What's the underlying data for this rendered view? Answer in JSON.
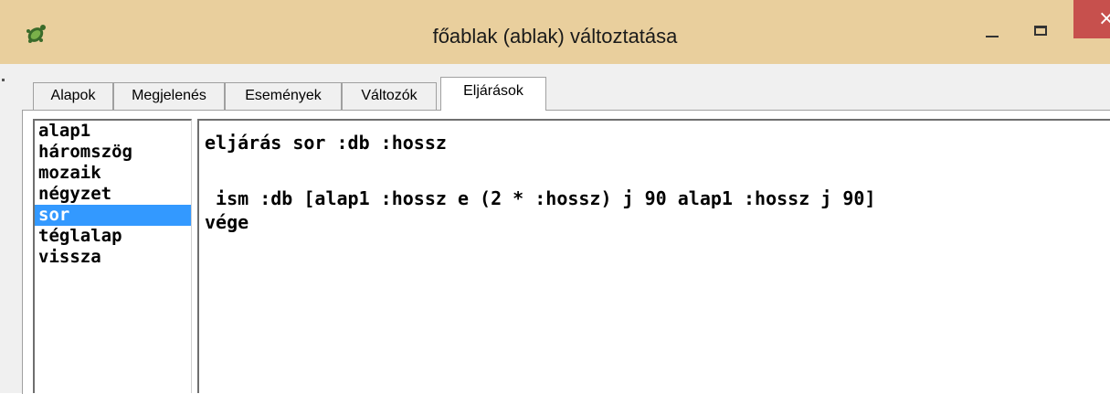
{
  "window": {
    "title": "főablak (ablak) változtatása",
    "close_glyph": "×"
  },
  "icons": {
    "app": "turtle-icon",
    "minimize": "minimize-icon",
    "maximize": "maximize-icon",
    "close": "close-icon"
  },
  "colors": {
    "titlebar": "#e9cf9d",
    "close": "#c7504d",
    "selection": "#3399ff"
  },
  "tabs": [
    {
      "label": "Alapok"
    },
    {
      "label": "Megjelenés"
    },
    {
      "label": "Események"
    },
    {
      "label": "Változók"
    },
    {
      "label": "Eljárások",
      "active": true
    }
  ],
  "procedures": {
    "items": [
      "alap1",
      "háromszög",
      "mozaik",
      "négyzet",
      "sor",
      "téglalap",
      "vissza"
    ],
    "selected": "sor"
  },
  "editor": {
    "lines": [
      "eljárás sor :db :hossz",
      "",
      " ism :db [alap1 :hossz e (2 * :hossz) j 90 alap1 :hossz j 90]",
      "vége"
    ]
  }
}
